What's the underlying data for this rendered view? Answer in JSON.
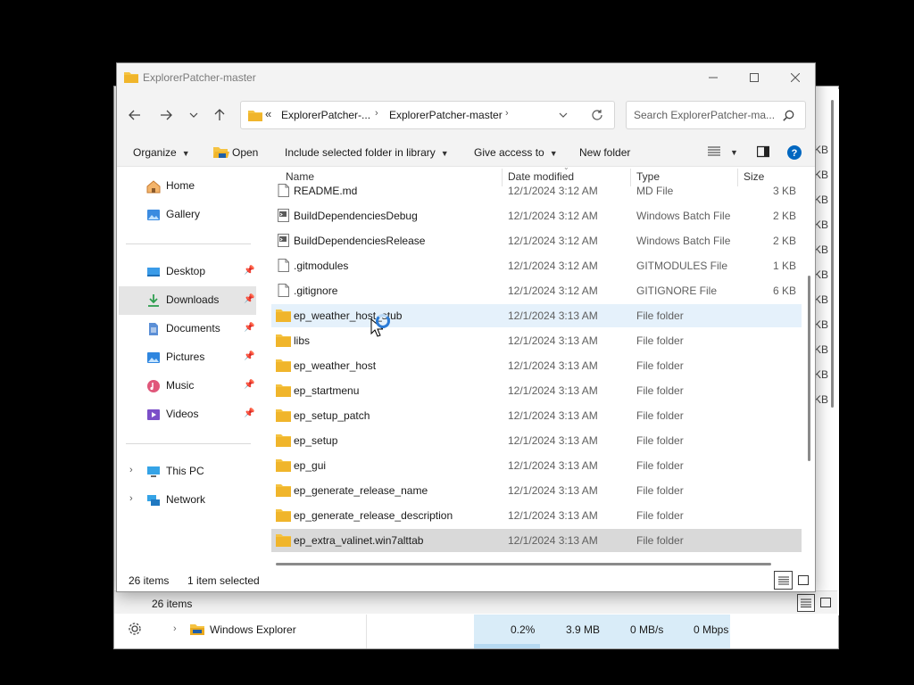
{
  "window": {
    "title": "ExplorerPatcher-master"
  },
  "address": {
    "overflow": "«",
    "crumbs": [
      "ExplorerPatcher-...",
      "ExplorerPatcher-master"
    ]
  },
  "search": {
    "placeholder": "Search ExplorerPatcher-ma..."
  },
  "toolbar": {
    "organize": "Organize",
    "open": "Open",
    "include": "Include selected folder in library",
    "share": "Give access to",
    "new_folder": "New folder"
  },
  "nav": {
    "home": "Home",
    "gallery": "Gallery",
    "desktop": "Desktop",
    "downloads": "Downloads",
    "documents": "Documents",
    "pictures": "Pictures",
    "music": "Music",
    "videos": "Videos",
    "thispc": "This PC",
    "network": "Network"
  },
  "columns": {
    "name": "Name",
    "date": "Date modified",
    "type": "Type",
    "size": "Size"
  },
  "files": [
    {
      "name": "README.md",
      "date": "12/1/2024 3:12 AM",
      "type": "MD File",
      "size": "3 KB",
      "icon": "doc-icon"
    },
    {
      "name": "BuildDependenciesDebug",
      "date": "12/1/2024 3:12 AM",
      "type": "Windows Batch File",
      "size": "2 KB",
      "icon": "batch-icon"
    },
    {
      "name": "BuildDependenciesRelease",
      "date": "12/1/2024 3:12 AM",
      "type": "Windows Batch File",
      "size": "2 KB",
      "icon": "batch-icon"
    },
    {
      "name": ".gitmodules",
      "date": "12/1/2024 3:12 AM",
      "type": "GITMODULES File",
      "size": "1 KB",
      "icon": "doc-icon"
    },
    {
      "name": ".gitignore",
      "date": "12/1/2024 3:12 AM",
      "type": "GITIGNORE File",
      "size": "6 KB",
      "icon": "doc-icon"
    },
    {
      "name": "ep_weather_host_stub",
      "date": "12/1/2024 3:13 AM",
      "type": "File folder",
      "size": "",
      "icon": "folder-icon"
    },
    {
      "name": "libs",
      "date": "12/1/2024 3:13 AM",
      "type": "File folder",
      "size": "",
      "icon": "folder-icon"
    },
    {
      "name": "ep_weather_host",
      "date": "12/1/2024 3:13 AM",
      "type": "File folder",
      "size": "",
      "icon": "folder-icon"
    },
    {
      "name": "ep_startmenu",
      "date": "12/1/2024 3:13 AM",
      "type": "File folder",
      "size": "",
      "icon": "folder-icon"
    },
    {
      "name": "ep_setup_patch",
      "date": "12/1/2024 3:13 AM",
      "type": "File folder",
      "size": "",
      "icon": "folder-icon"
    },
    {
      "name": "ep_setup",
      "date": "12/1/2024 3:13 AM",
      "type": "File folder",
      "size": "",
      "icon": "folder-icon"
    },
    {
      "name": "ep_gui",
      "date": "12/1/2024 3:13 AM",
      "type": "File folder",
      "size": "",
      "icon": "folder-icon"
    },
    {
      "name": "ep_generate_release_name",
      "date": "12/1/2024 3:13 AM",
      "type": "File folder",
      "size": "",
      "icon": "folder-icon"
    },
    {
      "name": "ep_generate_release_description",
      "date": "12/1/2024 3:13 AM",
      "type": "File folder",
      "size": "",
      "icon": "folder-icon"
    },
    {
      "name": "ep_extra_valinet.win7alttab",
      "date": "12/1/2024 3:13 AM",
      "type": "File folder",
      "size": "",
      "icon": "folder-icon"
    }
  ],
  "hovered_row": 5,
  "selected_row": 14,
  "status": {
    "count": "26 items",
    "selection": "1 item selected"
  },
  "background": {
    "status_count": "26 items",
    "kb_label": "KB",
    "process": {
      "name": "Windows Explorer",
      "cpu": "0.2%",
      "memory": "3.9 MB",
      "disk": "0 MB/s",
      "network": "0 Mbps"
    }
  },
  "colors": {
    "accent": "#0067c0",
    "folder": "#f5c342",
    "hover": "#e5f1fb",
    "selected": "#d9d9d9"
  }
}
